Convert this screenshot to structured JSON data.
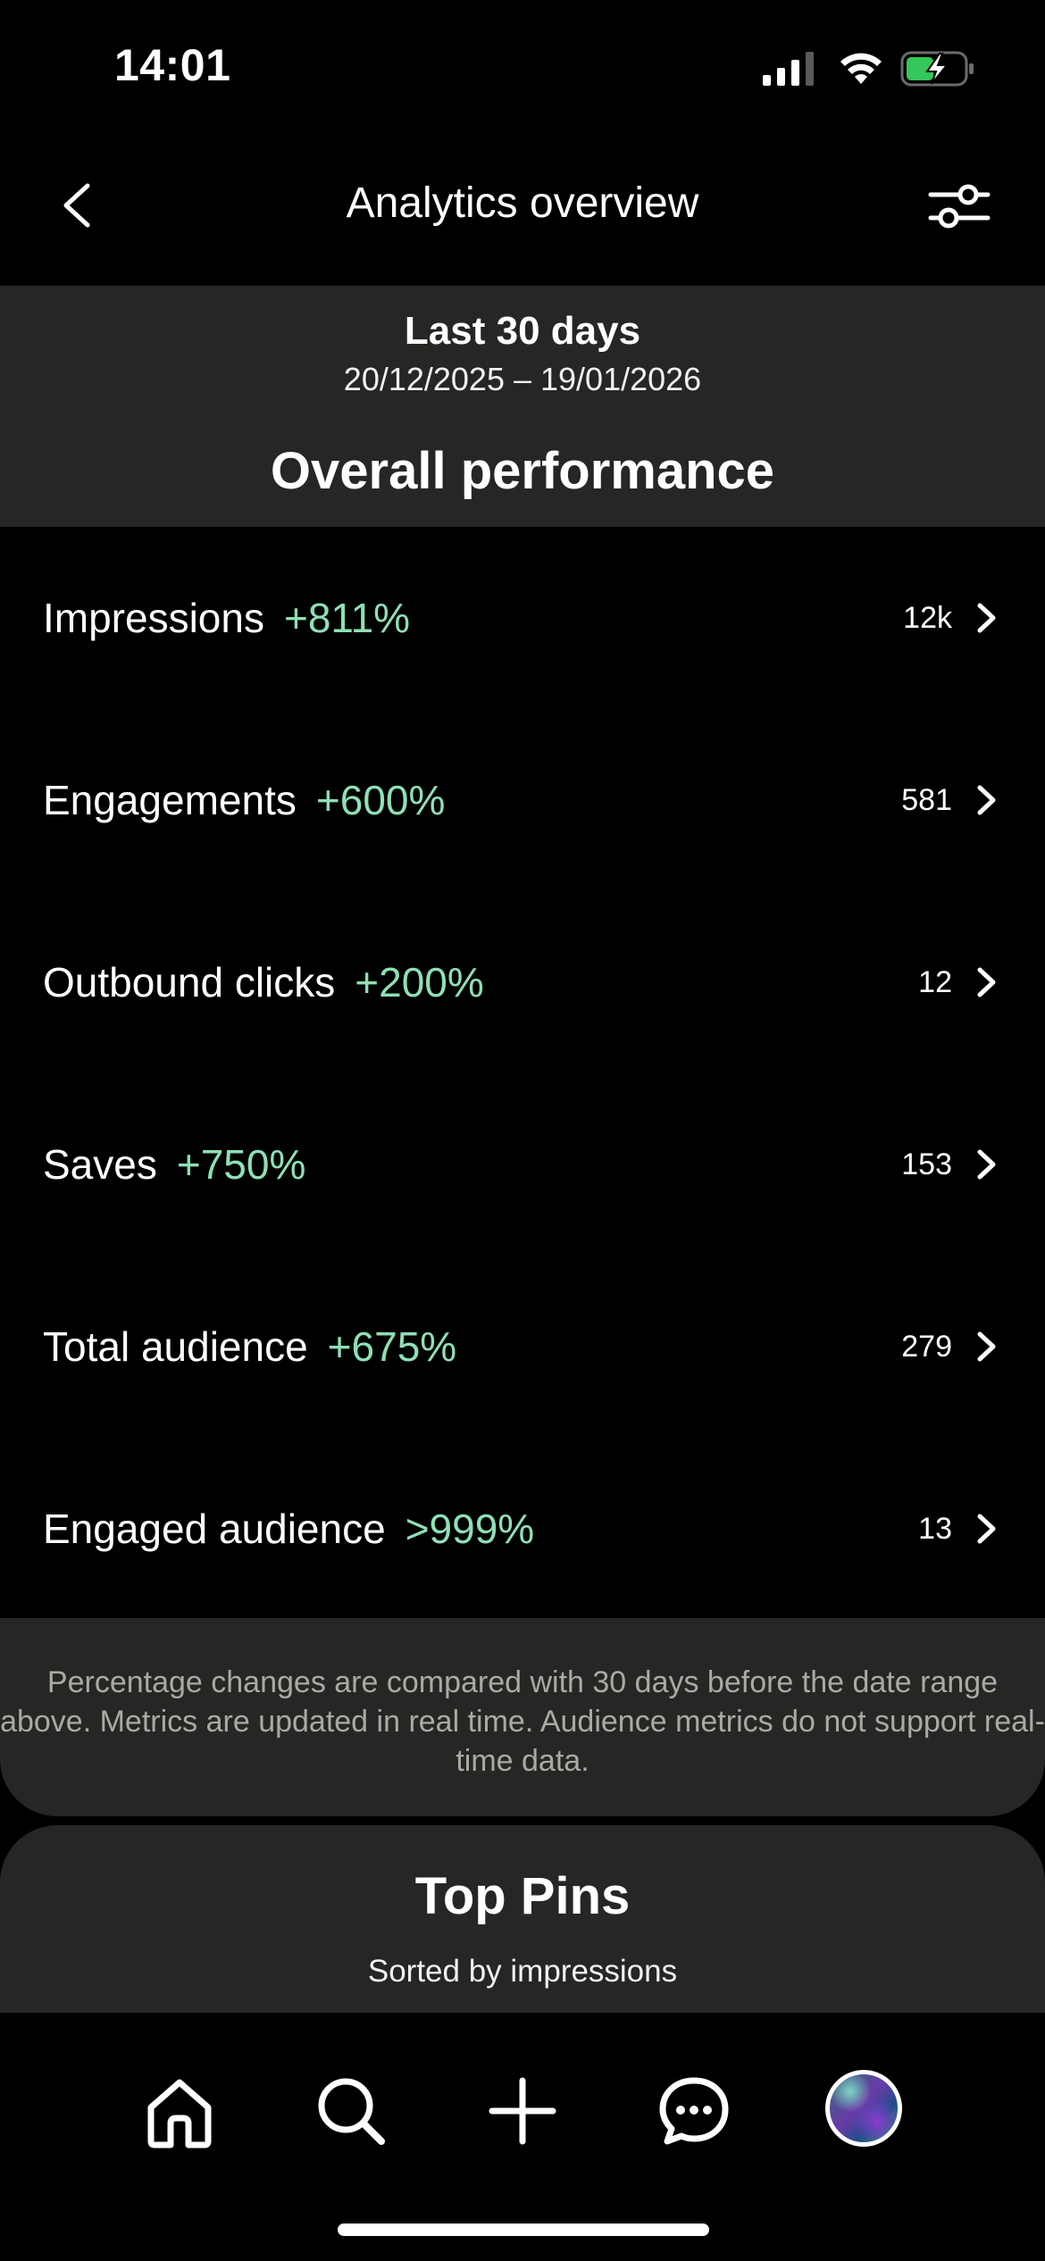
{
  "status_bar": {
    "time": "14:01",
    "icons": [
      "cellular-signal-icon",
      "wifi-icon",
      "battery-charging-icon"
    ],
    "battery_color": "#34c759"
  },
  "header": {
    "title": "Analytics overview",
    "back_icon": "chevron-left-icon",
    "filter_icon": "sliders-icon"
  },
  "date_range": {
    "label": "Last 30 days",
    "dates": "20/12/2025 – 19/01/2026"
  },
  "overall": {
    "title": "Overall performance"
  },
  "metrics": [
    {
      "name": "Impressions",
      "change": "+811%",
      "value": "12k"
    },
    {
      "name": "Engagements",
      "change": "+600%",
      "value": "581"
    },
    {
      "name": "Outbound clicks",
      "change": "+200%",
      "value": "12"
    },
    {
      "name": "Saves",
      "change": "+750%",
      "value": "153"
    },
    {
      "name": "Total audience",
      "change": "+675%",
      "value": "279"
    },
    {
      "name": "Engaged audience",
      "change": ">999%",
      "value": "13"
    }
  ],
  "note": {
    "text": "Percentage changes are compared with 30 days before the date range above. Metrics are updated in real time. Audience metrics do not support real-time data."
  },
  "top_pins": {
    "title": "Top Pins",
    "subtitle": "Sorted by impressions"
  },
  "bottom_nav": {
    "items": [
      "home-icon",
      "search-icon",
      "create-plus-icon",
      "messages-icon",
      "profile-avatar"
    ]
  },
  "colors": {
    "positive_change": "#8ee0b5",
    "card_background": "#262624",
    "background": "#000000"
  }
}
